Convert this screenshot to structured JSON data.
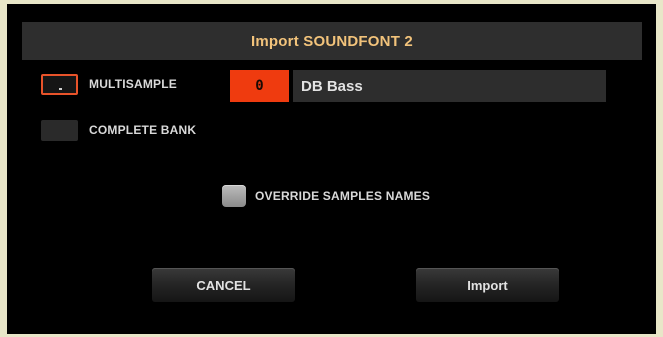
{
  "dialog": {
    "title": "Import SOUNDFONT 2"
  },
  "options": {
    "multisample": {
      "label": "MULTISAMPLE",
      "selected": true
    },
    "complete_bank": {
      "label": "COMPLETE BANK",
      "selected": false
    }
  },
  "sample": {
    "number": "0",
    "name": "DB Bass"
  },
  "override": {
    "label": "OVERRIDE SAMPLES NAMES",
    "checked": false
  },
  "buttons": {
    "cancel_label": "CANCEL",
    "import_label": "Import"
  },
  "colors": {
    "accent": "#ef3b0f",
    "title_text": "#f2c37b",
    "background": "#000000",
    "frame": "#e8e6c8"
  }
}
